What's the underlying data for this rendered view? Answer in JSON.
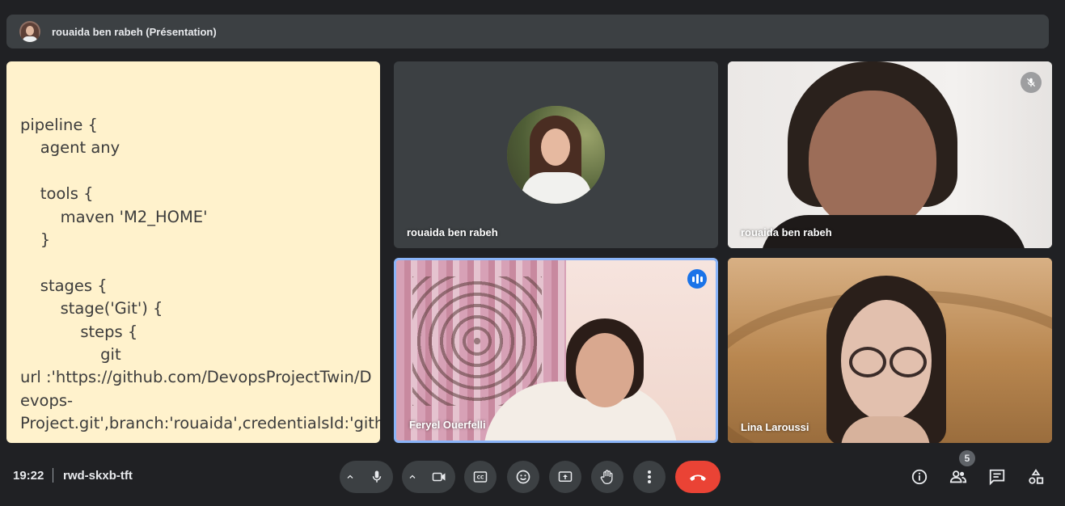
{
  "presenter_bar": {
    "title": "rouaida ben rabeh (Présentation)"
  },
  "presentation": {
    "lines": [
      "pipeline {",
      "    agent any",
      "",
      "    tools {",
      "        maven 'M2_HOME'",
      "    }",
      "",
      "    stages {",
      "        stage('Git') {",
      "            steps {",
      "                git",
      "url :'https://github.com/DevopsProjectTwin/D",
      "evops-",
      "Project.git',branch:'rouaida',credentialsId:'gith"
    ]
  },
  "participants": [
    {
      "name": "rouaida ben rabeh",
      "state": "avatar"
    },
    {
      "name": "rouaida ben rabeh",
      "state": "muted"
    },
    {
      "name": "Feryel Ouerfelli",
      "state": "speaking"
    },
    {
      "name": "Lina Laroussi",
      "state": "video"
    }
  ],
  "footer": {
    "time": "19:22",
    "meeting_code": "rwd-skxb-tft",
    "participant_count": "5"
  },
  "colors": {
    "background": "#202124",
    "tile": "#3c4043",
    "hangup": "#ea4335",
    "speaking": "#1a73e8",
    "active_border": "#8ab4f8",
    "presentation_bg": "#fff2cc"
  }
}
